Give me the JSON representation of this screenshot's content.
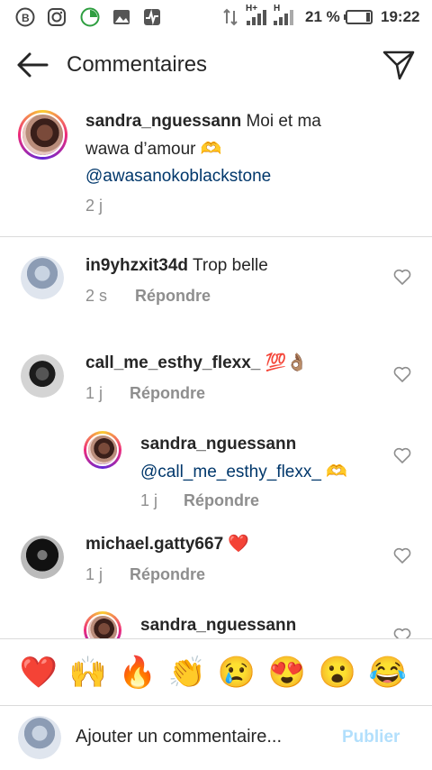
{
  "status_bar": {
    "battery": "21 %",
    "time": "19:22",
    "network_1": "H+",
    "network_2": "H"
  },
  "header": {
    "title": "Commentaires"
  },
  "caption": {
    "username": "sandra_nguessann",
    "text_1": "Moi et ma",
    "text_2": "wawa d’amour 🫶",
    "mention": "@awasanokoblackstone",
    "time": "2 j"
  },
  "comments": [
    {
      "username": "in9yhzxit34d",
      "text": "Trop belle",
      "time": "2 s",
      "reply": "Répondre"
    },
    {
      "username": "call_me_esthy_flexx_",
      "text": "💯👌🏽",
      "time": "1 j",
      "reply": "Répondre"
    },
    {
      "username": "sandra_nguessann",
      "mention": "@call_me_esthy_flexx_",
      "emoji": "🫶",
      "time": "1 j",
      "reply": "Répondre"
    },
    {
      "username": "michael.gatty667",
      "text": "❤️",
      "time": "1 j",
      "reply": "Répondre"
    },
    {
      "username": "sandra_nguessann"
    }
  ],
  "emoji_bar": [
    "❤️",
    "🙌",
    "🔥",
    "👏",
    "😢",
    "😍",
    "😮",
    "😂"
  ],
  "composer": {
    "placeholder": "Ajouter un commentaire...",
    "publish": "Publier"
  },
  "colors": {
    "mention": "#00376b",
    "meta": "#8e8e8e",
    "publish_disabled": "#b2dffc",
    "divider": "#dbdbdb"
  }
}
